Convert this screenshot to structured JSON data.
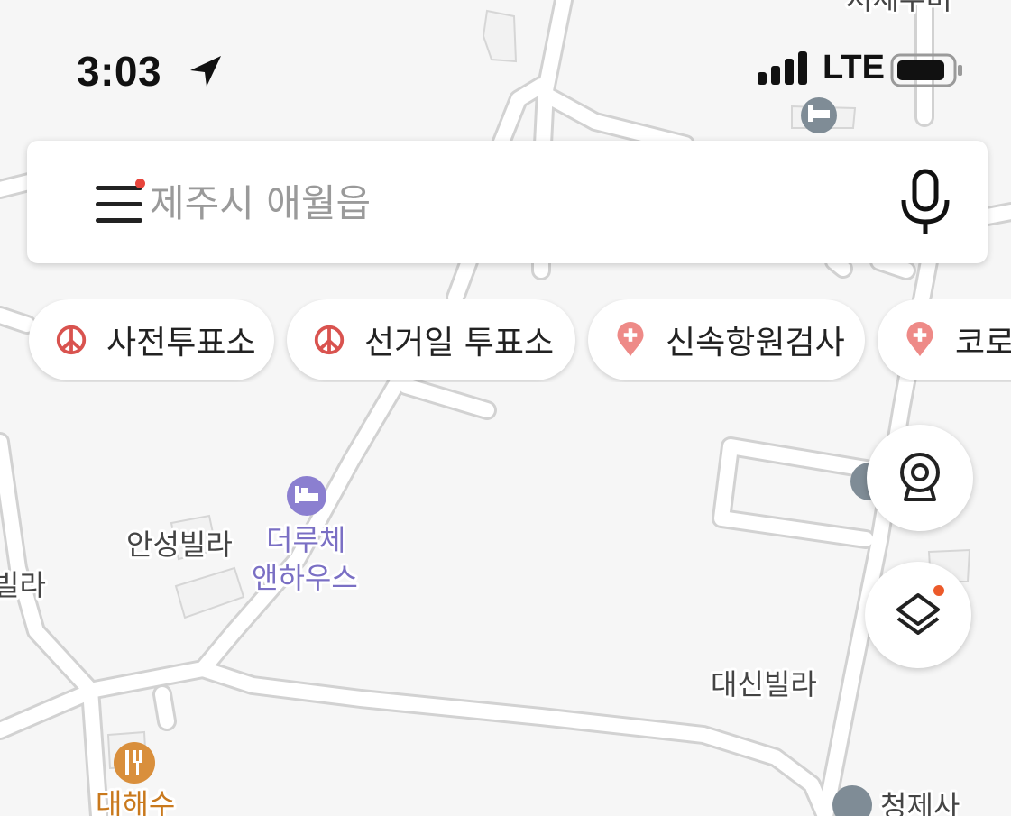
{
  "status_bar": {
    "time": "3:03",
    "network": "LTE"
  },
  "search": {
    "placeholder": "제주시 애월읍"
  },
  "chips": [
    {
      "label": "사전투표소",
      "icon": "ballot-icon"
    },
    {
      "label": "선거일 투표소",
      "icon": "ballot-icon"
    },
    {
      "label": "신속항원검사",
      "icon": "medical-pin-icon"
    },
    {
      "label": "코로",
      "icon": "medical-pin-icon"
    }
  ],
  "map_labels": {
    "top_partial": "저세우미",
    "ansung_villa": "안성빌라",
    "pension_line1": "더루체",
    "pension_line2": "앤하우스",
    "left_villa": "빌라",
    "daeshin_villa": "대신빌라",
    "restaurant": "대해수",
    "temple": "청제사"
  },
  "colors": {
    "pension_purple": "#8b7fd0",
    "restaurant_orange": "#d98f3c",
    "lodging_gray": "#7f8c96",
    "chip_red": "#d9534f",
    "notification_dot": "#e8453c"
  }
}
